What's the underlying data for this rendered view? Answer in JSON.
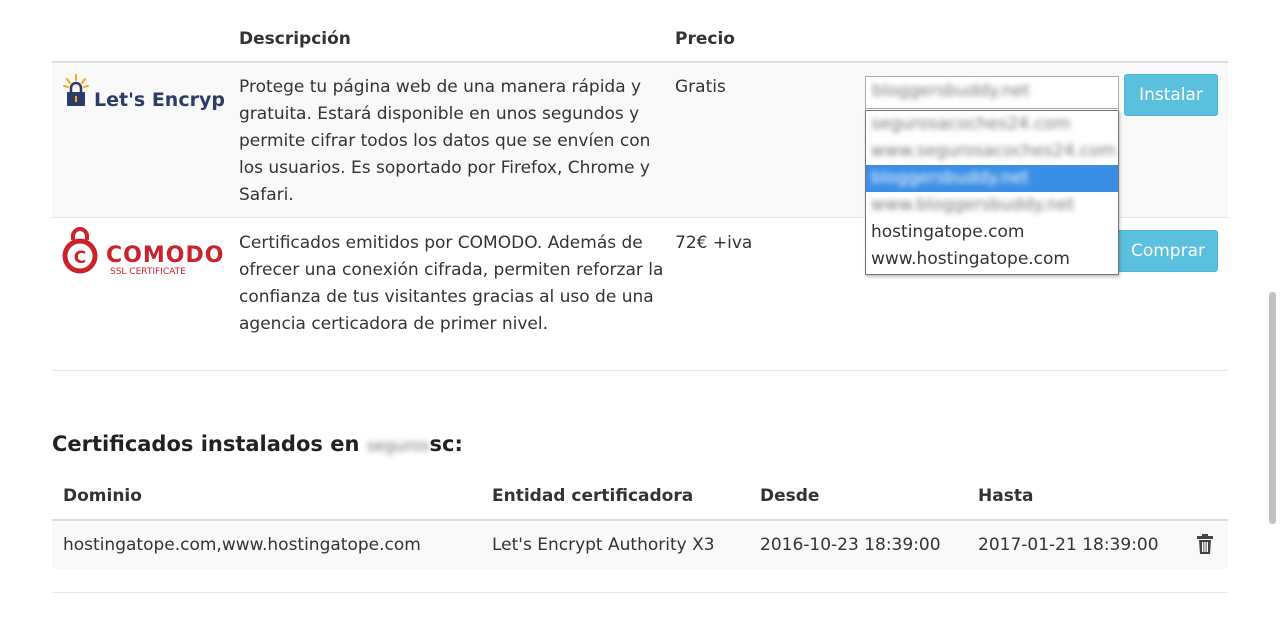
{
  "products_table": {
    "headers": {
      "description": "Descripción",
      "price": "Precio"
    },
    "rows": [
      {
        "logo_text": "Let's Encrypt",
        "description": "Protege tu página web de una manera rápida y gratuita. Estará disponible en unos segundos y permite cifrar todos los datos que se envíen con los usuarios. Es soportado por Firefox, Chrome y Safari.",
        "price": "Gratis",
        "button": "Instalar"
      },
      {
        "logo_text": "COMODO",
        "logo_subtext": "SSL CERTIFICATE",
        "description": "Certificados emitidos por COMODO. Además de ofrecer una conexión cifrada, permiten reforzar la confianza de tus visitantes gracias al uso de una agencia certicadora de primer nivel.",
        "price": "72€ +iva",
        "button": "Comprar"
      }
    ]
  },
  "domain_select": {
    "selected": "bloggersbuddy.net",
    "options": [
      {
        "label": "segurosacoches24.com",
        "blurred": true
      },
      {
        "label": "www.segurosacoches24.com",
        "blurred": true
      },
      {
        "label": "bloggersbuddy.net",
        "blurred": true,
        "selected": true
      },
      {
        "label": "www.bloggersbuddy.net",
        "blurred": true
      },
      {
        "label": "hostingatope.com",
        "blurred": false
      },
      {
        "label": "www.hostingatope.com",
        "blurred": false
      }
    ]
  },
  "installed": {
    "title_prefix": "Certificados instalados en",
    "title_blurred_part": "seguros",
    "title_suffix": "sc:",
    "headers": {
      "domain": "Dominio",
      "authority": "Entidad certificadora",
      "from": "Desde",
      "to": "Hasta"
    },
    "rows": [
      {
        "domain": "hostingatope.com,www.hostingatope.com",
        "authority": "Let's Encrypt Authority X3",
        "from": "2016-10-23 18:39:00",
        "to": "2017-01-21 18:39:00",
        "action_icon": "trash-icon"
      }
    ]
  },
  "colors": {
    "button": "#5bc0de",
    "selected_option": "#3a8ee6",
    "comodo_red": "#cc2229",
    "letsencrypt_blue": "#2c3c69",
    "letsencrypt_yellow": "#f9a61a"
  }
}
